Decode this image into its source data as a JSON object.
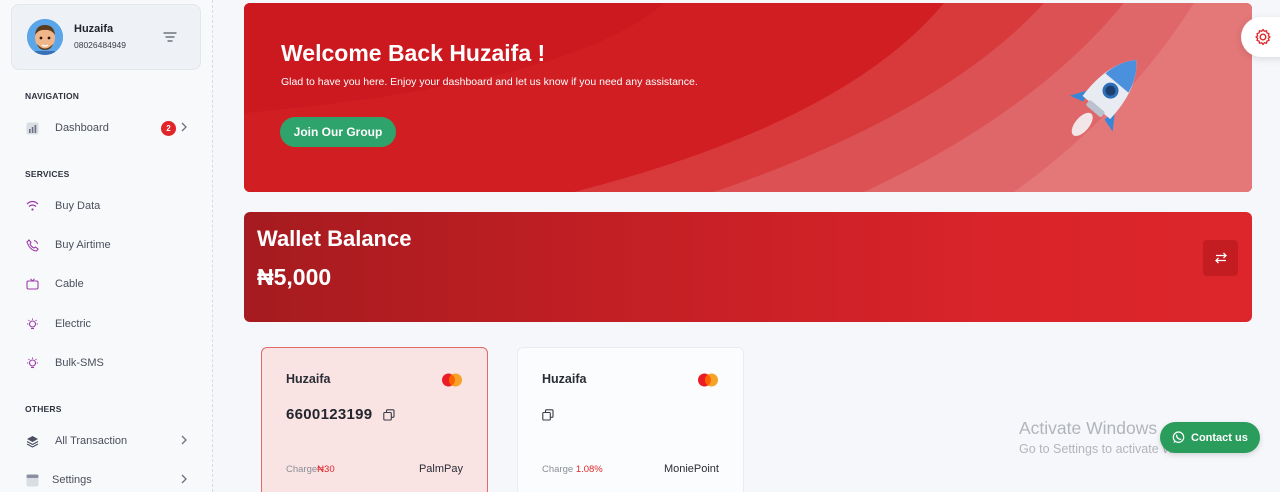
{
  "sidebar": {
    "user": {
      "name": "Huzaifa",
      "phone": "08026484949"
    },
    "sections": {
      "navigation": "NAVIGATION",
      "services": "SERVICES",
      "others": "OTHERS"
    },
    "items": {
      "dashboard": {
        "label": "Dashboard",
        "badge": "2",
        "icon": "chart-icon"
      },
      "buy_data": {
        "label": "Buy Data",
        "icon": "wifi-icon"
      },
      "buy_airtime": {
        "label": "Buy Airtime",
        "icon": "phone-icon"
      },
      "cable": {
        "label": "Cable",
        "icon": "tv-icon"
      },
      "electric": {
        "label": "Electric",
        "icon": "bulb-icon"
      },
      "bulk_sms": {
        "label": "Bulk-SMS",
        "icon": "bulb-icon"
      },
      "all_transaction": {
        "label": "All Transaction",
        "icon": "layers-icon"
      },
      "settings": {
        "label": "Settings",
        "icon": "calendar-icon"
      }
    }
  },
  "welcome": {
    "title": "Welcome Back Huzaifa !",
    "subtitle": "Glad to have you here. Enjoy your dashboard and let us know if you need any assistance.",
    "join_label": "Join Our Group"
  },
  "wallet": {
    "title": "Wallet Balance",
    "amount": "₦5,000"
  },
  "cards": [
    {
      "name": "Huzaifa",
      "brand": "Mastercard",
      "account": "6600123199",
      "charge_label": "Charge",
      "charge_value": "₦30",
      "bank": "PalmPay"
    },
    {
      "name": "Huzaifa",
      "brand": "Mastercard",
      "account": "",
      "charge_label": "Charge",
      "charge_value": "1.08%",
      "bank": "MoniePoint"
    }
  ],
  "os_overlay": {
    "line1": "Activate Windows",
    "line2": "Go to Settings to activate Windows."
  },
  "contact_label": "Contact us",
  "colors": {
    "primary_red": "#d52025",
    "green": "#2ea36b",
    "whatsapp_green": "#2a9d5c",
    "badge_red": "#e0262a"
  }
}
